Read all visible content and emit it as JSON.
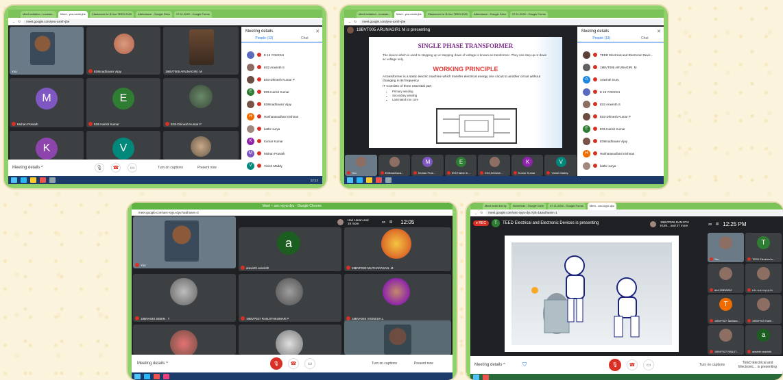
{
  "shot1": {
    "tabs": [
      "Meet invitation - koustav...",
      "Meet - yeu-oxmh-jbe",
      "Classroom for B.Voc TEED 2020",
      "Attendance - Google Drive",
      "07.11.2020 - Google Forms"
    ],
    "url": "meet.google.com/yeu-oxmh-jbe",
    "tiles": [
      {
        "name": "You"
      },
      {
        "name": "E08madhavan Vijay"
      },
      {
        "name": "19BVT005 ARUNAGIRI. M"
      },
      {
        "name": "Mohan Prasath",
        "initial": "M",
        "color": "#7e57c2"
      },
      {
        "name": "E05 Harish Kumar",
        "initial": "E",
        "color": "#2e7d32"
      },
      {
        "name": "E03-Dhinesh Kumar P"
      },
      {
        "name": "",
        "initial": "K",
        "color": "#8e44ad"
      },
      {
        "name": "",
        "initial": "V",
        "color": "#00897b"
      }
    ],
    "panel": {
      "title": "Meeting details",
      "people_tab": "People (13)",
      "chat_tab": "Chat",
      "people": [
        {
          "name": "E 15 YOKESH",
          "color": "#5c6bc0"
        },
        {
          "name": "E02 Aravinth S",
          "color": "#8d6e63"
        },
        {
          "name": "E03-Dhinesh Kumar P",
          "color": "#6d4c41"
        },
        {
          "name": "E05 Harish Kumar",
          "initial": "E",
          "color": "#2e7d32"
        },
        {
          "name": "E08madhavan Vijay",
          "color": "#795548"
        },
        {
          "name": "Hariharasudhan krishnan",
          "initial": "H",
          "color": "#ef6c00"
        },
        {
          "name": "kathir surya",
          "color": "#a1887f"
        },
        {
          "name": "Kumar Kumar",
          "initial": "K",
          "color": "#8e24aa"
        },
        {
          "name": "Mohan Prasath",
          "initial": "M",
          "color": "#7e57c2"
        },
        {
          "name": "Vinish Maddy",
          "initial": "V",
          "color": "#00897b"
        }
      ]
    },
    "bottom": {
      "meeting_details": "Meeting details",
      "captions": "Turn on captions",
      "present": "Present now",
      "time": "12:12"
    }
  },
  "shot2": {
    "presenter": "19BVT005 ARUNAGIRI. M is presenting",
    "slide": {
      "title": "SINGLE PHASE TRANSFORMER",
      "intro": "The device which is used to stepping up or stepping down of voltage is known as transformer .They can step up or down ac voltage only.",
      "heading": "WORKING PRINCIPLE",
      "body": "A transformer is a static electric machine which transfer electrical energy one circuit to another circuit without changing in its frequency",
      "parts_label": "IT Consists of three essential part",
      "parts": [
        "Primary winding",
        "Secondary winding",
        "Laminated iron core"
      ]
    },
    "strip": [
      {
        "name": "You"
      },
      {
        "name": "E08madhava..."
      },
      {
        "name": "Mohan Pras...",
        "initial": "M",
        "color": "#7e57c2"
      },
      {
        "name": "E05 Harish K...",
        "initial": "E",
        "color": "#2e7d32"
      },
      {
        "name": "E03-Dhinesh..."
      },
      {
        "name": "Kumar Kumar",
        "initial": "K",
        "color": "#8e24aa"
      },
      {
        "name": "Vinish Maddy",
        "initial": "V",
        "color": "#00897b"
      }
    ],
    "panel": {
      "title": "Meeting details",
      "people_tab": "People (13)",
      "chat_tab": "Chat",
      "people": [
        {
          "name": "TEED Electrical and Electronic Devic...",
          "color": "#5d4037"
        },
        {
          "name": "19BVT005 ARUNAGIRI. M",
          "color": "#616161"
        },
        {
          "name": "Aravinth Guru",
          "initial": "A",
          "color": "#1e88e5"
        },
        {
          "name": "E 15 YOKESH",
          "color": "#5c6bc0"
        },
        {
          "name": "E02 Aravinth S",
          "color": "#8d6e63"
        },
        {
          "name": "E03-Dhinesh Kumar P",
          "color": "#6d4c41"
        },
        {
          "name": "E05 Harish Kumar",
          "initial": "E",
          "color": "#2e7d32"
        },
        {
          "name": "E08madhavan Vijay",
          "color": "#795548"
        },
        {
          "name": "Hariharasudhan krishnan",
          "initial": "H",
          "color": "#ef6c00"
        },
        {
          "name": "kathir surya",
          "color": "#a1887f"
        }
      ]
    }
  },
  "shot3": {
    "window_title": "Meet – uec-syyu-dyu - Google Chrome",
    "url": "meet.google.com/uec-syyu-dyu?authuser=0",
    "top_user": "Hari Haran and 19 more",
    "people_count": "20",
    "time": "12:05",
    "tiles": [
      {
        "name": "You"
      },
      {
        "name": "aravinth aravinth",
        "initial": "a",
        "color": "#1b5e20"
      },
      {
        "name": "19BVP020 MUTHARASAN. M"
      },
      {
        "name": "19BVA040 SEBIN . T"
      },
      {
        "name": "19BVP027 RANJITHKUMAR P"
      },
      {
        "name": "19BVA046 VIGNESH.L"
      }
    ],
    "bottom": {
      "meeting_details": "Meeting details",
      "captions": "Turn on captions",
      "present": "Present now"
    }
  },
  "shot4": {
    "tabs": [
      "Meet invite link by",
      "November - Google Drive",
      "07.11.2020 - Google Forms",
      "Meet - uec-syyu-dyu"
    ],
    "url": "meet.google.com/uec-syyu-dyu?pli=1&authuser=1",
    "rec": "REC",
    "presenter_initial": "T",
    "presenter": "TEED Electrical and Electronic Devices is presenting",
    "top_user": "19BVP026 RANJITH KUM... and 27 more",
    "people_count": "28",
    "time": "12:25 PM",
    "side": [
      {
        "name": "You"
      },
      {
        "name": "TEED Electrical a...",
        "initial": "T",
        "color": "#2e7d32"
      },
      {
        "name": "arul 19BVA003"
      },
      {
        "name": "s.k...s.p.r.u.p.p.i.n"
      },
      {
        "name": "19BVP027 Tamilara...",
        "initial": "T",
        "color": "#ef6c00"
      },
      {
        "name": "19BVP010 Harih..."
      },
      {
        "name": "19BVP027 RANJIT..."
      },
      {
        "name": "aravinth aravinth",
        "initial": "a",
        "color": "#1b5e20"
      }
    ],
    "bottom": {
      "meeting_details": "Meeting details",
      "captions": "Turn on captions",
      "present": "TEED Electrical and Electronic... is presenting"
    }
  }
}
